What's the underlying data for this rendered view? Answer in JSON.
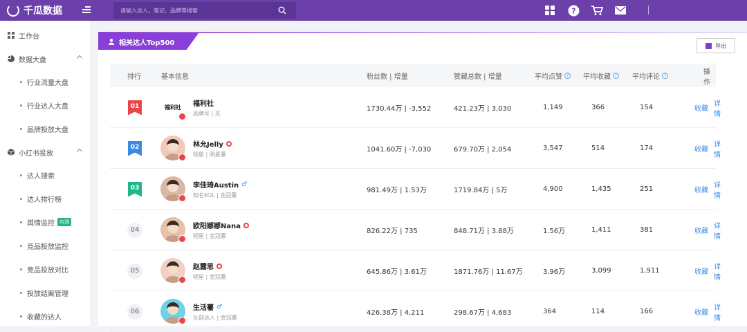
{
  "app": {
    "name": "千瓜数据"
  },
  "search": {
    "placeholder": "请输入达人、笔记、品牌等搜索"
  },
  "sidebar": {
    "items": [
      {
        "label": "工作台"
      },
      {
        "label": "数据大盘"
      },
      {
        "label": "行业流量大盘"
      },
      {
        "label": "行业达人大盘"
      },
      {
        "label": "品牌投放大盘"
      },
      {
        "label": "小红书投放"
      },
      {
        "label": "达人搜索"
      },
      {
        "label": "达人排行榜"
      },
      {
        "label": "舆情监控",
        "badge": "内测"
      },
      {
        "label": "竞品投放监控"
      },
      {
        "label": "竞品投放对比"
      },
      {
        "label": "投放结案管理"
      },
      {
        "label": "收藏的达人"
      }
    ]
  },
  "panel": {
    "title": "相关达人Top500",
    "export_label": "导出"
  },
  "table": {
    "headers": {
      "rank": "排行",
      "info": "基本信息",
      "fans": "粉丝数 | 增量",
      "likes": "赞藏总数 | 增量",
      "avg_like": "平均点赞",
      "avg_collect": "平均收藏",
      "avg_comment": "平均评论",
      "action": "操作"
    },
    "rows": [
      {
        "rank": "01",
        "name": "福利社",
        "avatar_text": "福利社",
        "tag1": "品牌号",
        "tag2": "无",
        "fans": "1730.44万 | -3,552",
        "likes": "421.23万 | 3,030",
        "avg_like": "1,149",
        "avg_collect": "366",
        "avg_comment": "154",
        "fav": "收藏",
        "detail": "详情"
      },
      {
        "rank": "02",
        "name": "林允Jelly",
        "tag1": "明星",
        "tag2": "明星薯",
        "fans": "1041.60万 | -7,030",
        "likes": "679.70万 | 2,054",
        "avg_like": "3,547",
        "avg_collect": "514",
        "avg_comment": "174",
        "fav": "收藏",
        "detail": "详情"
      },
      {
        "rank": "03",
        "name": "李佳琦Austin",
        "tag1": "知名KOL",
        "tag2": "金冠薯",
        "fans": "981.49万 | 1.53万",
        "likes": "1719.84万 | 5万",
        "avg_like": "4,900",
        "avg_collect": "1,435",
        "avg_comment": "251",
        "fav": "收藏",
        "detail": "详情"
      },
      {
        "rank": "04",
        "name": "欧阳娜娜Nana",
        "tag1": "明星",
        "tag2": "金冠薯",
        "fans": "826.22万 | 735",
        "likes": "848.71万 | 3.88万",
        "avg_like": "1.56万",
        "avg_collect": "1,411",
        "avg_comment": "381",
        "fav": "收藏",
        "detail": "详情"
      },
      {
        "rank": "05",
        "name": "赵露思",
        "tag1": "明星",
        "tag2": "金冠薯",
        "fans": "645.86万 | 3.61万",
        "likes": "1871.76万 | 11.67万",
        "avg_like": "3.96万",
        "avg_collect": "3,099",
        "avg_comment": "1,911",
        "fav": "收藏",
        "detail": "详情"
      },
      {
        "rank": "06",
        "name": "生活薯",
        "tag1": "头部达人",
        "tag2": "金冠薯",
        "fans": "426.38万 | 4,211",
        "likes": "298.67万 | 4,683",
        "avg_like": "364",
        "avg_collect": "114",
        "avg_comment": "166",
        "fav": "收藏",
        "detail": "详情"
      }
    ]
  },
  "colors": {
    "topbar": "#6b40a8",
    "accent": "#8a3fd8",
    "link": "#3b8ae6",
    "rank1": "#e8474a",
    "rank2": "#3b8ae6",
    "rank3": "#22b58a"
  }
}
